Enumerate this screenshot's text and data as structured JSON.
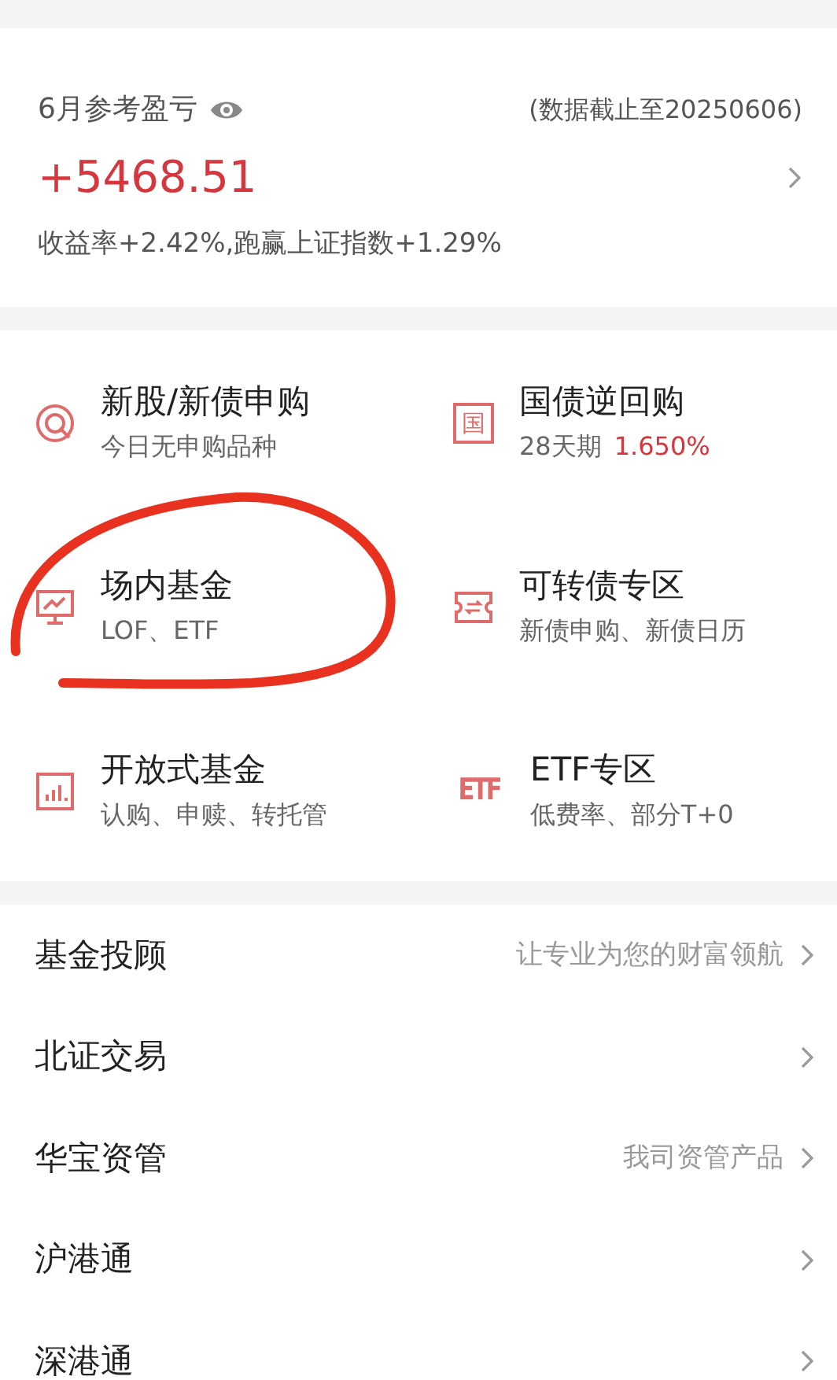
{
  "summary": {
    "label": "6月参考盈亏",
    "as_of": "(数据截止至20250606)",
    "amount": "+5468.51",
    "note": "收益率+2.42%,跑赢上证指数+1.29%"
  },
  "features": [
    {
      "kind": "target",
      "title": "新股/新债申购",
      "subtitle": "今日无申购品种",
      "circled": false
    },
    {
      "kind": "glyph",
      "icon_text": "国",
      "title": "国债逆回购",
      "subtitle": "28天期",
      "rate": "1.650%",
      "circled": false
    },
    {
      "kind": "monitor",
      "title": "场内基金",
      "subtitle": "LOF、ETF",
      "circled": true
    },
    {
      "kind": "ticket",
      "title": "可转债专区",
      "subtitle": "新债申购、新债日历",
      "circled": false
    },
    {
      "kind": "bars",
      "title": "开放式基金",
      "subtitle": "认购、申赎、转托管",
      "circled": false
    },
    {
      "kind": "logo",
      "icon_text": "ETF",
      "title": "ETF专区",
      "subtitle": "低费率、部分T+0",
      "circled": false
    }
  ],
  "menu": [
    {
      "label": "基金投顾",
      "hint": "让专业为您的财富领航"
    },
    {
      "label": "北证交易"
    },
    {
      "label": "华宝资管",
      "hint": "我司资管产品"
    },
    {
      "label": "沪港通"
    },
    {
      "label": "深港通"
    }
  ]
}
